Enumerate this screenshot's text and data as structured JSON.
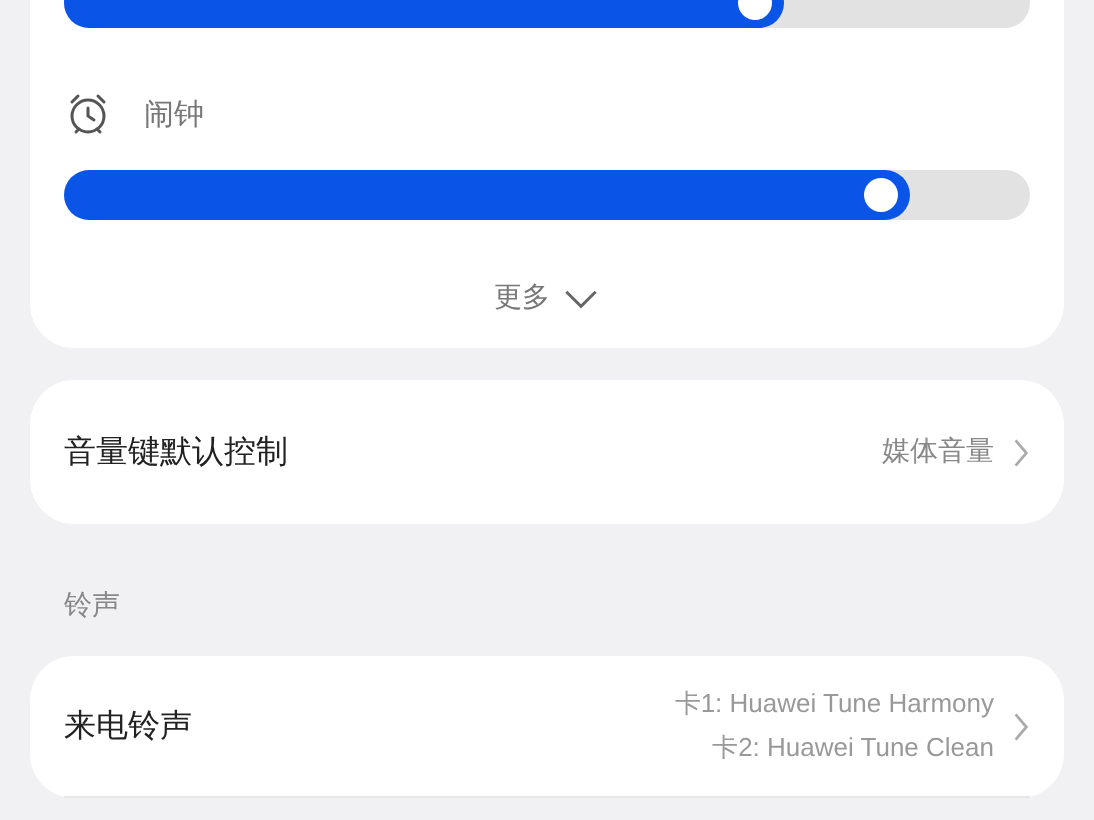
{
  "volume_card": {
    "sliders": [
      {
        "level": 0.745
      },
      {
        "label": "闹钟",
        "level": 0.875
      }
    ],
    "more": "更多"
  },
  "volume_key": {
    "label": "音量键默认控制",
    "value": "媒体音量"
  },
  "ringtone_section": {
    "title": "铃声",
    "rows": [
      {
        "label": "来电铃声",
        "values": [
          "卡1: Huawei Tune Harmony",
          "卡2: Huawei Tune Clean"
        ]
      }
    ]
  }
}
